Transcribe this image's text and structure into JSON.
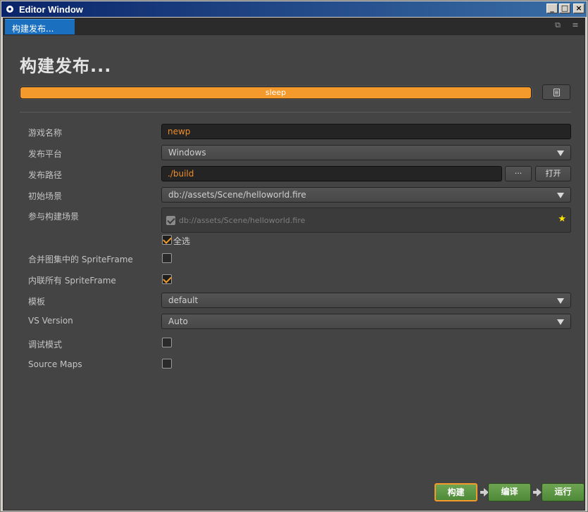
{
  "window": {
    "title": "Editor Window"
  },
  "tab": {
    "label": "构建发布..."
  },
  "page": {
    "title": "构建发布..."
  },
  "progress": {
    "label": "sleep",
    "fraction": 1.0
  },
  "form": {
    "game_name": {
      "label": "游戏名称",
      "value": "newp"
    },
    "platform": {
      "label": "发布平台",
      "value": "Windows"
    },
    "build_path": {
      "label": "发布路径",
      "value": "./build",
      "browse_label": "···",
      "open_label": "打开"
    },
    "start_scene": {
      "label": "初始场景",
      "value": "db://assets/Scene/helloworld.fire"
    },
    "included_scenes": {
      "label": "参与构建场景",
      "items": [
        "db://assets/Scene/helloworld.fire"
      ],
      "select_all_label": "全选",
      "select_all_checked": true
    },
    "merge_spriteframe": {
      "label": "合并图集中的 SpriteFrame",
      "checked": false
    },
    "inline_spriteframe": {
      "label": "内联所有 SpriteFrame",
      "checked": true
    },
    "template": {
      "label": "模板",
      "value": "default"
    },
    "vs_version": {
      "label": "VS Version",
      "value": "Auto"
    },
    "debug_mode": {
      "label": "调试模式",
      "checked": false
    },
    "source_maps": {
      "label": "Source Maps",
      "checked": false
    }
  },
  "actions": {
    "build": "构建",
    "compile": "编译",
    "run": "运行"
  },
  "colors": {
    "accent": "#f49a2c",
    "action_green": "#5e9a44",
    "tab_blue": "#1a6fbf"
  }
}
